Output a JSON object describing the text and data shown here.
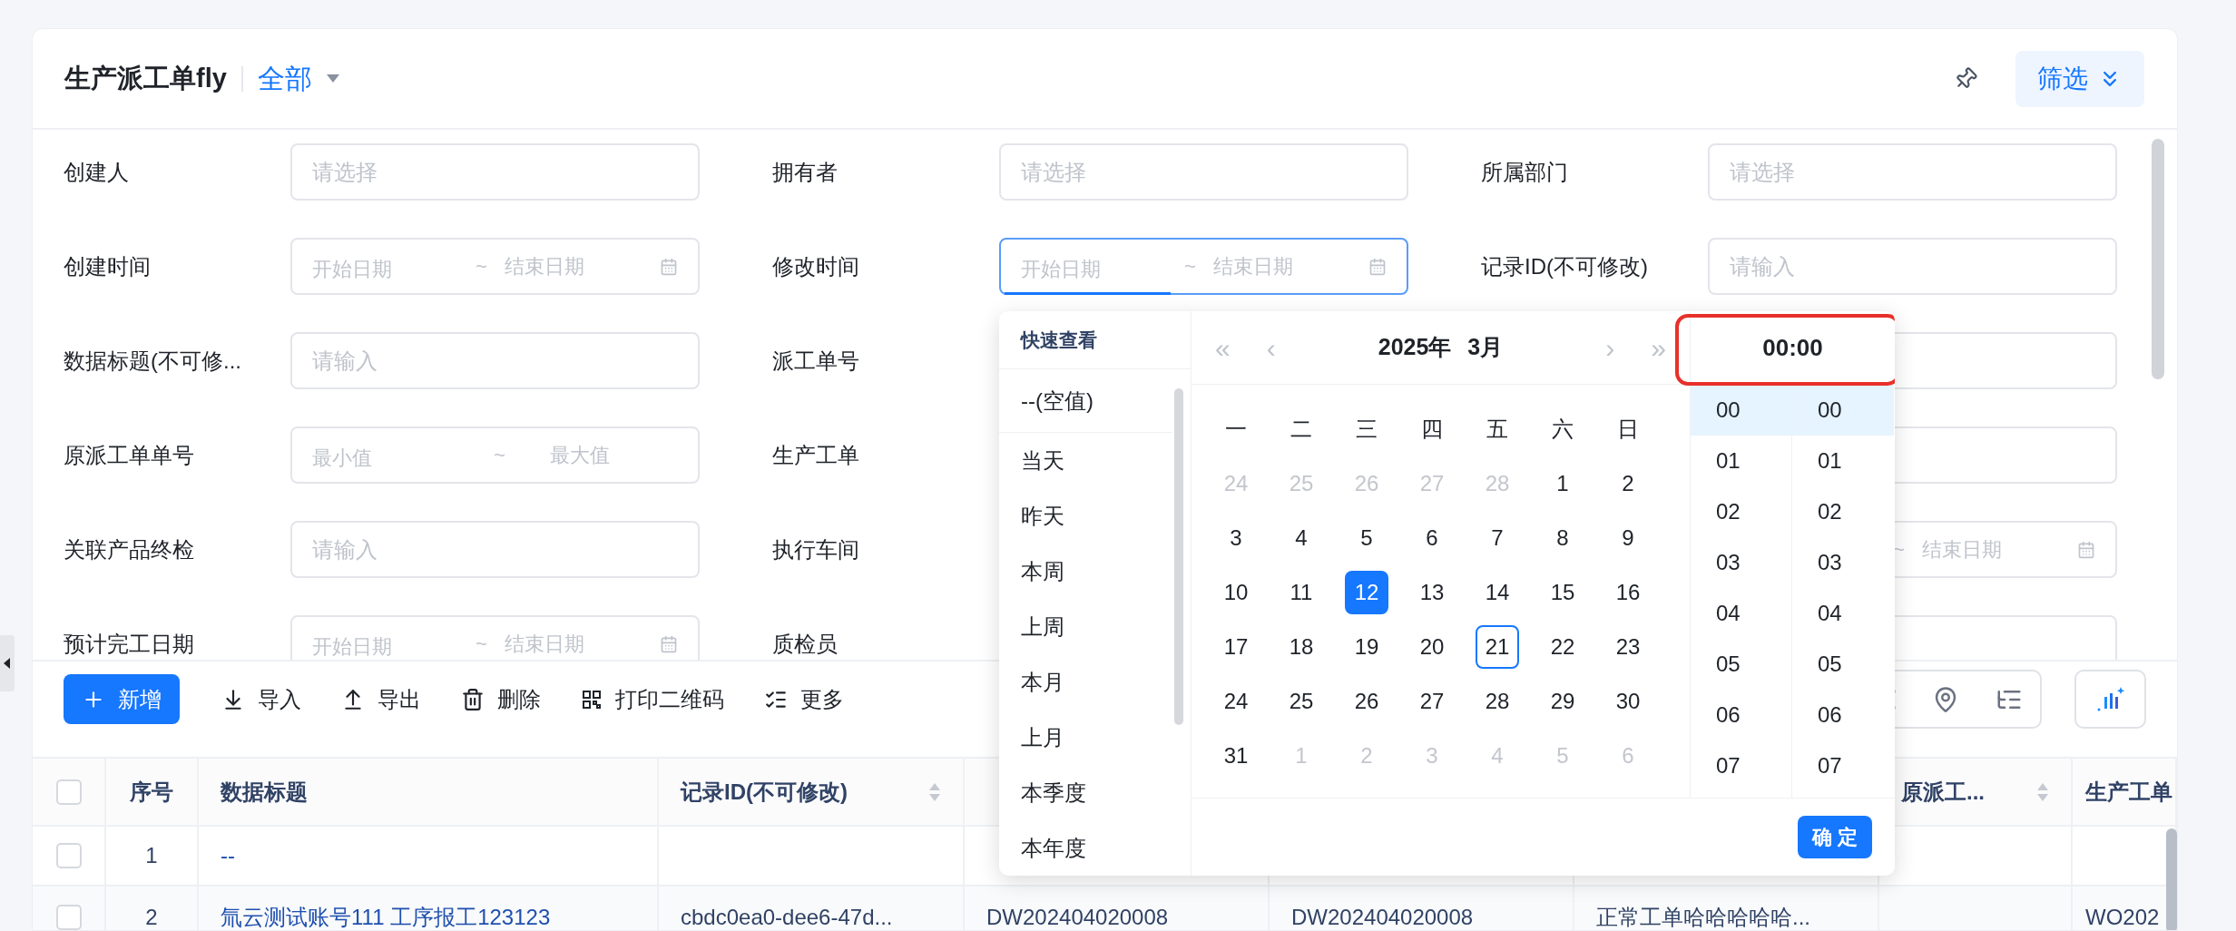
{
  "header": {
    "title": "生产派工单fly",
    "view": "全部",
    "filter_button": "筛选"
  },
  "filters": [
    [
      {
        "label": "创建人",
        "field": {
          "kind": "text",
          "placeholder": "请选择"
        }
      },
      {
        "label": "拥有者",
        "field": {
          "kind": "text",
          "placeholder": "请选择"
        }
      },
      {
        "label": "所属部门",
        "field": {
          "kind": "text",
          "placeholder": "请选择"
        }
      }
    ],
    [
      {
        "label": "创建时间",
        "field": {
          "kind": "date_range",
          "start": "开始日期",
          "separator": "~",
          "end": "结束日期",
          "focused": false
        }
      },
      {
        "label": "修改时间",
        "field": {
          "kind": "date_range",
          "start": "开始日期",
          "separator": "~",
          "end": "结束日期",
          "focused": true
        }
      },
      {
        "label": "记录ID(不可修改)",
        "field": {
          "kind": "text",
          "placeholder": "请输入"
        }
      }
    ],
    [
      {
        "label": "数据标题(不可修...",
        "field": {
          "kind": "text",
          "placeholder": "请输入"
        }
      },
      {
        "label": "派工单号",
        "field": {
          "kind": "hidden"
        }
      },
      {
        "field": {
          "kind": "text"
        }
      }
    ],
    [
      {
        "label": "原派工单单号",
        "field": {
          "kind": "number_range",
          "start": "最小值",
          "separator": "~",
          "end": "最大值"
        }
      },
      {
        "label": "生产工单",
        "field": {
          "kind": "hidden"
        }
      },
      {
        "field": {
          "kind": "text"
        }
      }
    ],
    [
      {
        "label": "关联产品终检",
        "field": {
          "kind": "text",
          "placeholder": "请输入"
        }
      },
      {
        "label": "执行车间",
        "field": {
          "kind": "hidden"
        }
      },
      {
        "field": {
          "kind": "date_range",
          "separator": "~",
          "end": "结束日期",
          "focused": false
        }
      }
    ],
    [
      {
        "label": "预计完工日期",
        "field": {
          "kind": "date_range",
          "start": "开始日期",
          "separator": "~",
          "end": "结束日期",
          "focused": false
        }
      },
      {
        "label": "质检员",
        "field": {
          "kind": "hidden"
        }
      },
      {
        "field": {
          "kind": "text"
        }
      }
    ]
  ],
  "toolbar": [
    {
      "label": "新增",
      "kind": "primary"
    },
    {
      "label": "导入",
      "kind": "plain"
    },
    {
      "label": "导出",
      "kind": "plain"
    },
    {
      "label": "删除",
      "kind": "plain"
    },
    {
      "label": "打印二维码",
      "kind": "plain"
    },
    {
      "label": "更多",
      "kind": "plain"
    }
  ],
  "table": {
    "all_checked": false,
    "columns": [
      {
        "label": "序号"
      },
      {
        "label": "数据标题"
      },
      {
        "label": "记录ID(不可修改)",
        "sortable": true
      },
      {},
      {},
      {},
      {
        "label": "原派工...",
        "sortable": true
      },
      {
        "label": "生产工单"
      }
    ],
    "rows": [
      {
        "checked": false,
        "cells": [
          "1",
          "--",
          "",
          "",
          "",
          "",
          "",
          ""
        ]
      },
      {
        "checked": false,
        "cells": [
          "2",
          "氚云测试账号111 工序报工123123",
          "cbdc0ea0-dee6-47d...",
          "DW202404020008",
          "DW202404020008",
          "正常工单哈哈哈哈哈...",
          "",
          "WO202"
        ]
      }
    ]
  },
  "picker": {
    "quick_title": "快速查看",
    "quick_items": [
      {
        "label": "--(空值)",
        "kind": "empty"
      },
      {
        "label": "当天",
        "kind": "range"
      },
      {
        "label": "昨天",
        "kind": "range"
      },
      {
        "label": "本周",
        "kind": "range"
      },
      {
        "label": "上周",
        "kind": "range"
      },
      {
        "label": "本月",
        "kind": "range"
      },
      {
        "label": "上月",
        "kind": "range"
      },
      {
        "label": "本季度",
        "kind": "range"
      },
      {
        "label": "本年度",
        "kind": "range"
      }
    ],
    "nav": [
      "«",
      "‹",
      "›",
      "»"
    ],
    "year": "2025年",
    "month": "3月",
    "weekdays": [
      "一",
      "二",
      "三",
      "四",
      "五",
      "六",
      "日"
    ],
    "days": [
      {
        "label": "24",
        "muted": true,
        "selected": false,
        "today": false
      },
      {
        "label": "25",
        "muted": true,
        "selected": false,
        "today": false
      },
      {
        "label": "26",
        "muted": true,
        "selected": false,
        "today": false
      },
      {
        "label": "27",
        "muted": true,
        "selected": false,
        "today": false
      },
      {
        "label": "28",
        "muted": true,
        "selected": false,
        "today": false
      },
      {
        "label": "1",
        "muted": false,
        "selected": false,
        "today": false
      },
      {
        "label": "2",
        "muted": false,
        "selected": false,
        "today": false
      },
      {
        "label": "3",
        "muted": false,
        "selected": false,
        "today": false
      },
      {
        "label": "4",
        "muted": false,
        "selected": false,
        "today": false
      },
      {
        "label": "5",
        "muted": false,
        "selected": false,
        "today": false
      },
      {
        "label": "6",
        "muted": false,
        "selected": false,
        "today": false
      },
      {
        "label": "7",
        "muted": false,
        "selected": false,
        "today": false
      },
      {
        "label": "8",
        "muted": false,
        "selected": false,
        "today": false
      },
      {
        "label": "9",
        "muted": false,
        "selected": false,
        "today": false
      },
      {
        "label": "10",
        "muted": false,
        "selected": false,
        "today": false
      },
      {
        "label": "11",
        "muted": false,
        "selected": false,
        "today": false
      },
      {
        "label": "12",
        "muted": false,
        "selected": true,
        "today": false
      },
      {
        "label": "13",
        "muted": false,
        "selected": false,
        "today": false
      },
      {
        "label": "14",
        "muted": false,
        "selected": false,
        "today": false
      },
      {
        "label": "15",
        "muted": false,
        "selected": false,
        "today": false
      },
      {
        "label": "16",
        "muted": false,
        "selected": false,
        "today": false
      },
      {
        "label": "17",
        "muted": false,
        "selected": false,
        "today": false
      },
      {
        "label": "18",
        "muted": false,
        "selected": false,
        "today": false
      },
      {
        "label": "19",
        "muted": false,
        "selected": false,
        "today": false
      },
      {
        "label": "20",
        "muted": false,
        "selected": false,
        "today": false
      },
      {
        "label": "21",
        "muted": false,
        "selected": false,
        "today": true
      },
      {
        "label": "22",
        "muted": false,
        "selected": false,
        "today": false
      },
      {
        "label": "23",
        "muted": false,
        "selected": false,
        "today": false
      },
      {
        "label": "24",
        "muted": false,
        "selected": false,
        "today": false
      },
      {
        "label": "25",
        "muted": false,
        "selected": false,
        "today": false
      },
      {
        "label": "26",
        "muted": false,
        "selected": false,
        "today": false
      },
      {
        "label": "27",
        "muted": false,
        "selected": false,
        "today": false
      },
      {
        "label": "28",
        "muted": false,
        "selected": false,
        "today": false
      },
      {
        "label": "29",
        "muted": false,
        "selected": false,
        "today": false
      },
      {
        "label": "30",
        "muted": false,
        "selected": false,
        "today": false
      },
      {
        "label": "31",
        "muted": false,
        "selected": false,
        "today": false
      },
      {
        "label": "1",
        "muted": true,
        "selected": false,
        "today": false
      },
      {
        "label": "2",
        "muted": true,
        "selected": false,
        "today": false
      },
      {
        "label": "3",
        "muted": true,
        "selected": false,
        "today": false
      },
      {
        "label": "4",
        "muted": true,
        "selected": false,
        "today": false
      },
      {
        "label": "5",
        "muted": true,
        "selected": false,
        "today": false
      },
      {
        "label": "6",
        "muted": true,
        "selected": false,
        "today": false
      }
    ],
    "time": {
      "value": "00:00",
      "highlighted": true,
      "hours": [
        {
          "label": "00",
          "selected": true
        },
        {
          "label": "01",
          "selected": false
        },
        {
          "label": "02",
          "selected": false
        },
        {
          "label": "03",
          "selected": false
        },
        {
          "label": "04",
          "selected": false
        },
        {
          "label": "05",
          "selected": false
        },
        {
          "label": "06",
          "selected": false
        },
        {
          "label": "07",
          "selected": false
        }
      ],
      "minutes": [
        {
          "label": "00",
          "selected": true
        },
        {
          "label": "01",
          "selected": false
        },
        {
          "label": "02",
          "selected": false
        },
        {
          "label": "03",
          "selected": false
        },
        {
          "label": "04",
          "selected": false
        },
        {
          "label": "05",
          "selected": false
        },
        {
          "label": "06",
          "selected": false
        },
        {
          "label": "07",
          "selected": false
        }
      ]
    },
    "confirm": "确 定"
  }
}
